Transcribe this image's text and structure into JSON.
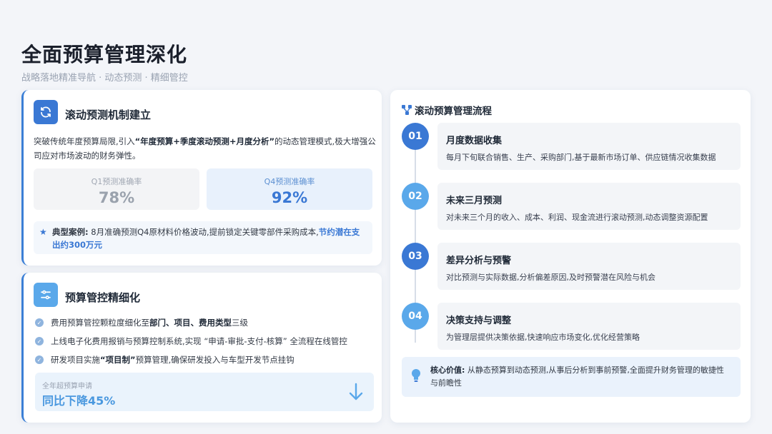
{
  "title": "全面预算管理深化",
  "subtitle": "战略落地精准导航 · 动态预测 · 精细管控",
  "card1": {
    "icon": "refresh-icon",
    "title": "滚动预测机制建立",
    "desc_pre": "突破传统年度预算局限,引入",
    "desc_bold": "“年度预算+季度滚动预测+月度分析”",
    "desc_post": "的动态管理模式,极大增强公司应对市场波动的财务弹性。",
    "metrics": [
      {
        "label": "Q1预测准确率",
        "value": "78%"
      },
      {
        "label": "Q4预测准确率",
        "value": "92%"
      }
    ],
    "case_label": "典型案例:",
    "case_text": "8月准确预测Q4原材料价格波动,提前锁定关键零部件采购成本,",
    "case_highlight": "节约潜在支出约300万元"
  },
  "card2": {
    "icon": "sliders-icon",
    "title": "预算管控精细化",
    "items": [
      {
        "pre": "费用预算管控颗粒度细化至",
        "bold": "部门、项目、费用类型",
        "post": "三级"
      },
      {
        "pre": "上线电子化费用报销与预算控制系统,实现 ",
        "bold": "",
        "post": "“申请-审批-支付-核算” 全流程在线管控"
      },
      {
        "pre": "研发项目实施",
        "bold": "“项目制”",
        "post": "预算管理,确保研发投入与车型开发节点挂钩"
      }
    ],
    "result_label": "全年超预算申请",
    "result_value": "同比下降45%"
  },
  "card3": {
    "title": "滚动预算管理流程",
    "steps": [
      {
        "num": "01",
        "title": "月度数据收集",
        "desc": "每月下旬联合销售、生产、采购部门,基于最新市场订单、供应链情况收集数据"
      },
      {
        "num": "02",
        "title": "未来三月预测",
        "desc": "对未来三个月的收入、成本、利润、现金流进行滚动预测,动态调整资源配置"
      },
      {
        "num": "03",
        "title": "差异分析与预警",
        "desc": "对比预测与实际数据,分析偏差原因,及时预警潜在风险与机会"
      },
      {
        "num": "04",
        "title": "决策支持与调整",
        "desc": "为管理层提供决策依据,快速响应市场变化,优化经营策略"
      }
    ],
    "core_label": "核心价值:",
    "core_text": "从静态预算到动态预测,从事后分析到事前预警,全面提升财务管理的敏捷性与前瞻性"
  },
  "colors": {
    "accent": "#3a78d4",
    "step_colors": [
      "#3a78d4",
      "#5aa8ea",
      "#3a78d4",
      "#5aa8ea"
    ]
  }
}
